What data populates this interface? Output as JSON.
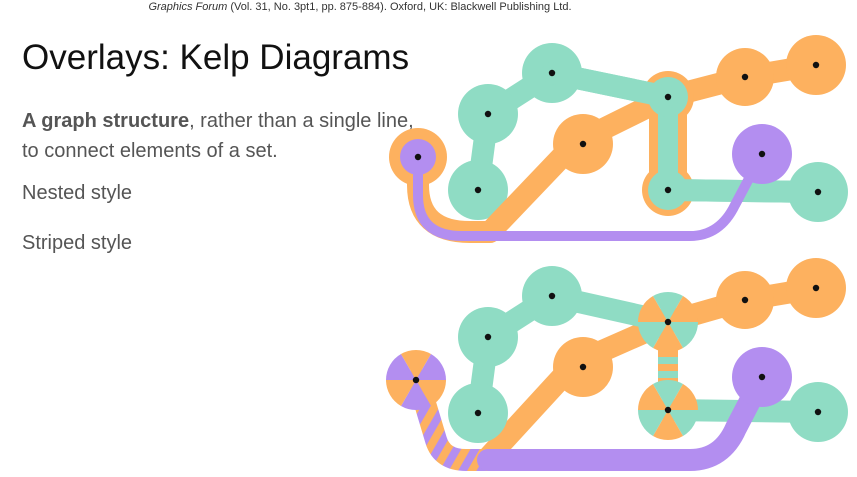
{
  "citation": {
    "journal": "Graphics Forum",
    "details": " (Vol. 31, No. 3pt1, pp. 875-884). Oxford, UK: Blackwell Publishing Ltd."
  },
  "slide": {
    "title": "Overlays: Kelp Diagrams",
    "bullet1_bold": "A graph structure",
    "bullet1_rest": ", rather than a single line, to connect elements of a set.",
    "bullet2": "Nested style",
    "bullet3": "Striped style"
  },
  "colors": {
    "teal": "#8fdcc4",
    "orange": "#fdb15f",
    "purple": "#b38ef0",
    "node_dot": "#111111"
  }
}
